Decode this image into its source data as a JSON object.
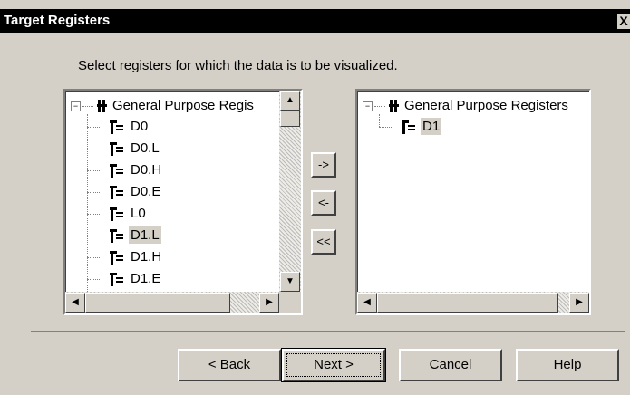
{
  "window": {
    "title": "Target Registers",
    "close_label": "X"
  },
  "instruction": "Select registers for which the data is to be visualized.",
  "left_tree": {
    "root_label": "General Purpose Regis",
    "expander": "−",
    "items": [
      {
        "label": "D0",
        "selected": false
      },
      {
        "label": "D0.L",
        "selected": false
      },
      {
        "label": "D0.H",
        "selected": false
      },
      {
        "label": "D0.E",
        "selected": false
      },
      {
        "label": "L0",
        "selected": false
      },
      {
        "label": "D1.L",
        "selected": true
      },
      {
        "label": "D1.H",
        "selected": false
      },
      {
        "label": "D1.E",
        "selected": false
      }
    ]
  },
  "right_tree": {
    "root_label": "General Purpose Registers",
    "expander": "−",
    "items": [
      {
        "label": "D1",
        "selected": true
      }
    ]
  },
  "transfer_buttons": {
    "add": "->",
    "remove": "<-",
    "remove_all": "<<"
  },
  "footer_buttons": {
    "back": "< Back",
    "next": "Next >",
    "cancel": "Cancel",
    "help": "Help"
  },
  "scroll_glyphs": {
    "up": "▲",
    "down": "▼",
    "left": "◀",
    "right": "▶"
  }
}
